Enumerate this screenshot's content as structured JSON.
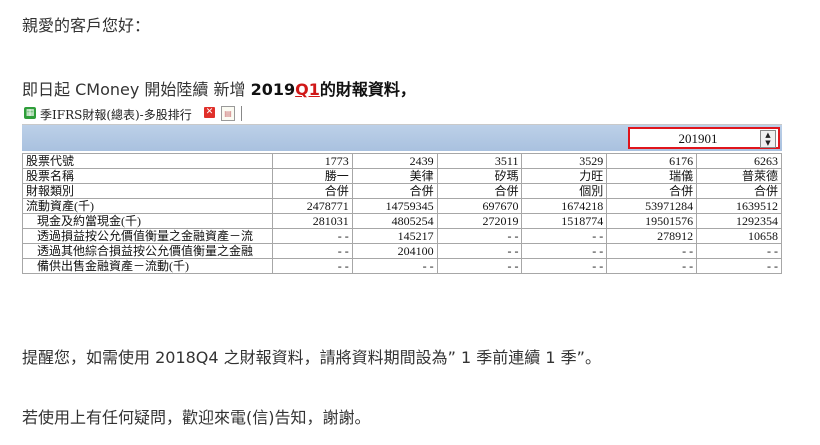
{
  "greeting": "親愛的客戶您好：",
  "intro": {
    "prefix": "即日起 CMoney 開始陸續 新增 ",
    "year": "2019",
    "quarter": "Q1",
    "suffix": "的財報資料，"
  },
  "tab": {
    "icon": "spreadsheet-icon",
    "title": "季IFRS財報(總表)-多股排行",
    "close": "close-icon",
    "new_tab": "new-tab-icon"
  },
  "period_selector": {
    "value": "201901"
  },
  "table": {
    "rows": [
      {
        "label": "股票代號",
        "indent": false,
        "cells": [
          "1773",
          "2439",
          "3511",
          "3529",
          "6176",
          "6263"
        ]
      },
      {
        "label": "股票名稱",
        "indent": false,
        "cells": [
          "勝一",
          "美律",
          "矽瑪",
          "力旺",
          "瑞儀",
          "普萊德"
        ]
      },
      {
        "label": "財報類別",
        "indent": false,
        "cells": [
          "合併",
          "合併",
          "合併",
          "個別",
          "合併",
          "合併"
        ]
      },
      {
        "label": "流動資產(千)",
        "indent": false,
        "cells": [
          "2478771",
          "14759345",
          "697670",
          "1674218",
          "53971284",
          "1639512"
        ]
      },
      {
        "label": "現金及約當現金(千)",
        "indent": true,
        "cells": [
          "281031",
          "4805254",
          "272019",
          "1518774",
          "19501576",
          "1292354"
        ]
      },
      {
        "label": "透過損益按公允價值衡量之金融資產－流",
        "indent": true,
        "cells": [
          "- -",
          "145217",
          "- -",
          "- -",
          "278912",
          "10658"
        ]
      },
      {
        "label": "透過其他綜合損益按公允價值衡量之金融",
        "indent": true,
        "cells": [
          "- -",
          "204100",
          "- -",
          "- -",
          "- -",
          "- -"
        ]
      },
      {
        "label": "備供出售金融資產－流動(千)",
        "indent": true,
        "cells": [
          "- -",
          "- -",
          "- -",
          "- -",
          "- -",
          "- -"
        ]
      }
    ]
  },
  "reminder": "提醒您，如需使用 2018Q4 之財報資料，請將資料期間設為” 1 季前連續 1 季”。",
  "contact": "若使用上有任何疑問，歡迎來電(信)告知，謝謝。"
}
